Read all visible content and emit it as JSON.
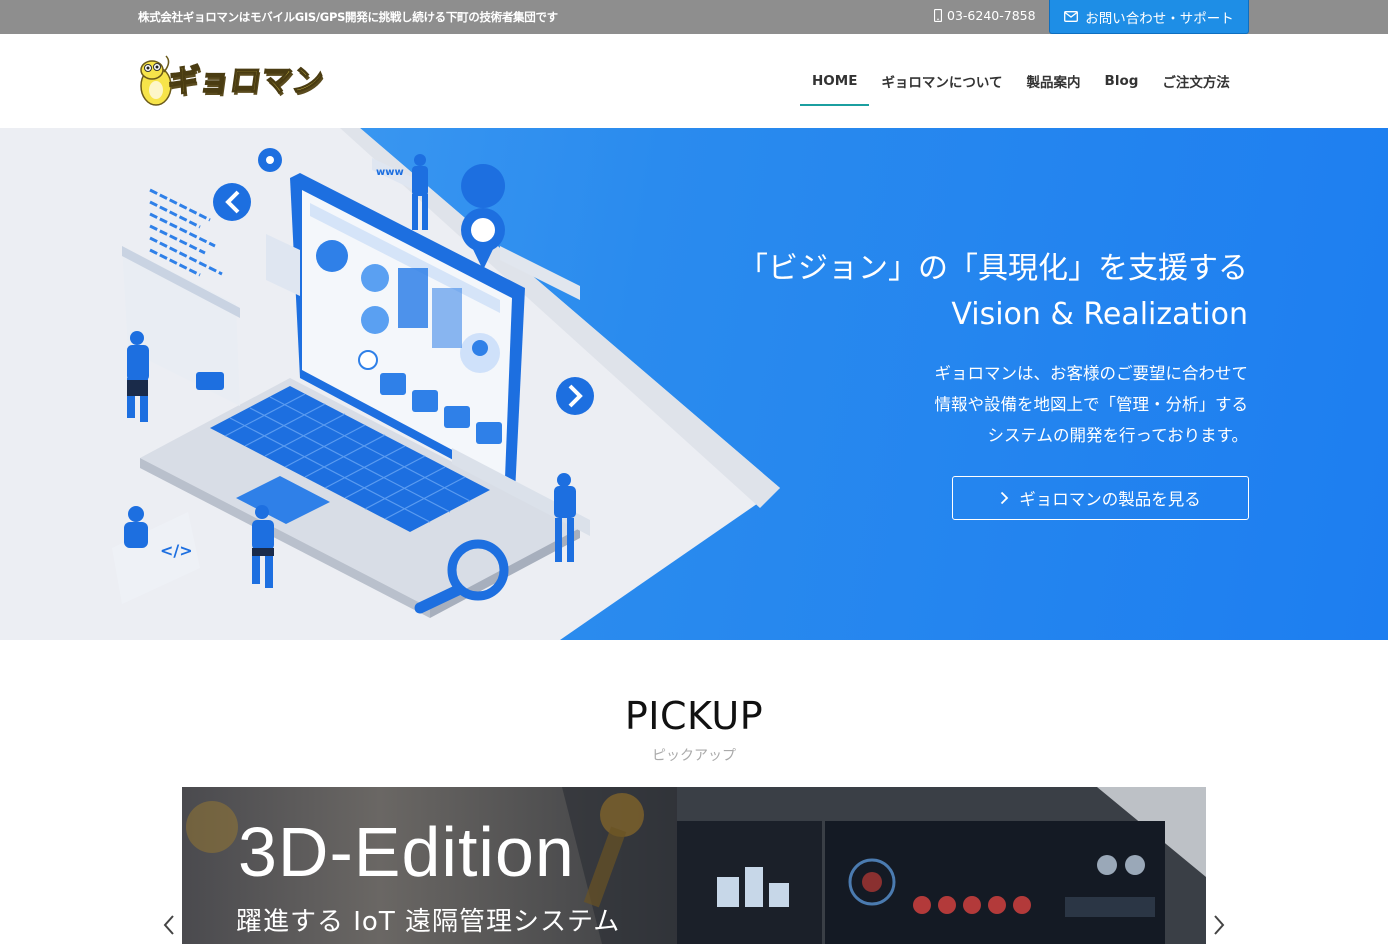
{
  "topbar": {
    "tagline": "株式会社ギョロマンはモバイルGIS/GPS開発に挑戦し続ける下町の技術者集団です",
    "phone": "03-6240-7858",
    "contact_label": "お問い合わせ・サポート"
  },
  "brand": {
    "logo_text": "ギョロマン"
  },
  "nav": {
    "items": [
      {
        "label": "HOME",
        "active": true
      },
      {
        "label": "ギョロマンについて"
      },
      {
        "label": "製品案内"
      },
      {
        "label": "Blog"
      },
      {
        "label": "ご注文方法"
      }
    ]
  },
  "hero": {
    "title_line1": "「ビジョン」の「具現化」を支援する",
    "title_line2": "Vision & Realization",
    "desc_line1": "ギョロマンは、お客様のご要望に合わせて",
    "desc_line2": "情報や設備を地図上で「管理・分析」する",
    "desc_line3": "システムの開発を行っております。",
    "button_label": "ギョロマンの製品を見る",
    "art_label": "www"
  },
  "pickup": {
    "title": "PICKUP",
    "subtitle": "ピックアップ",
    "banner_heading": "3D-Edition",
    "banner_sub": "躍進する IoT 遠隔管理システム"
  },
  "colors": {
    "topbar": "#8e8e8e",
    "accent_blue": "#1e8ee6",
    "nav_underline": "#1b9fa0",
    "hero_blue": "#2a8bee"
  }
}
